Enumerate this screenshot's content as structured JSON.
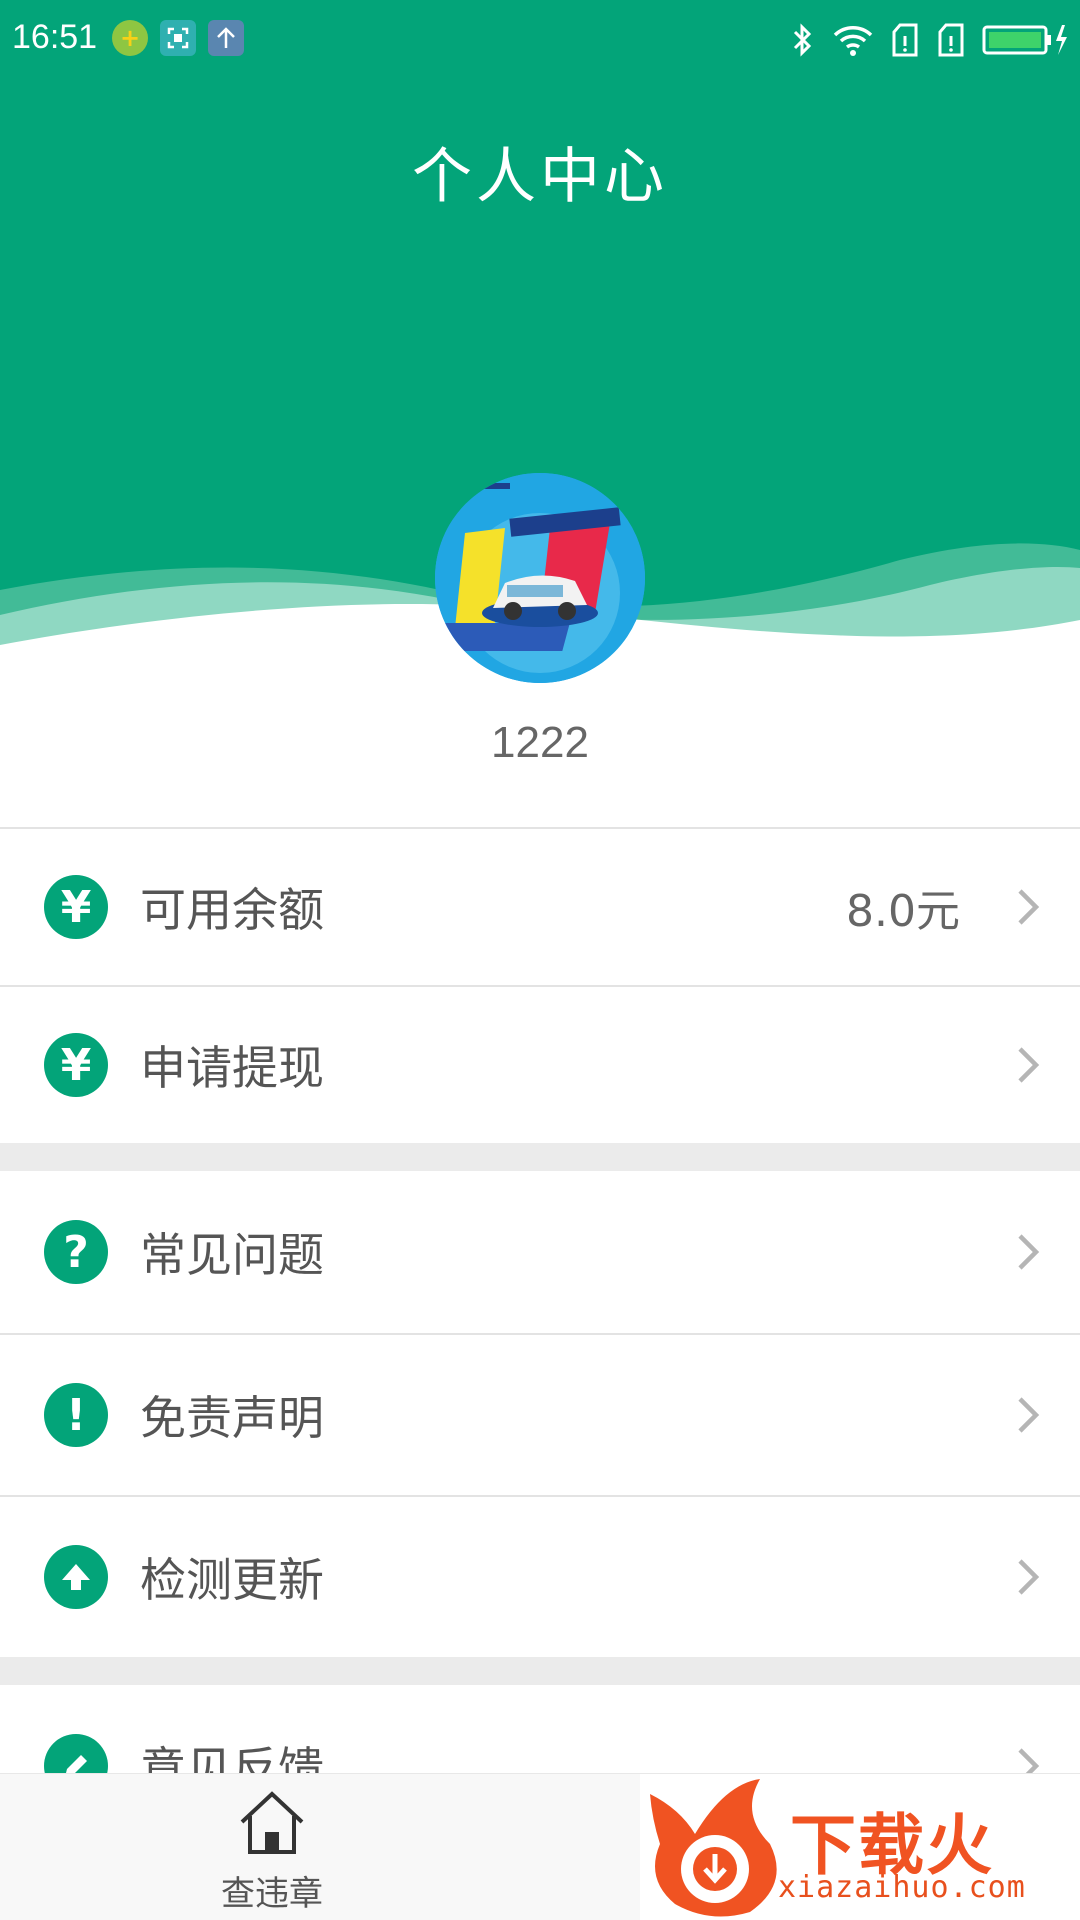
{
  "status_bar": {
    "time": "16:51"
  },
  "header": {
    "title": "个人中心",
    "background_color": "#03a479"
  },
  "profile": {
    "username": "1222",
    "avatar_icon": "car-promo-avatar"
  },
  "menu": {
    "balance": {
      "label": "可用余额",
      "value": "8.0元",
      "icon": "yen-icon"
    },
    "withdraw": {
      "label": "申请提现",
      "icon": "yen-icon"
    },
    "faq": {
      "label": "常见问题",
      "icon": "question-icon"
    },
    "disclaimer": {
      "label": "免责声明",
      "icon": "exclamation-icon"
    },
    "update": {
      "label": "检测更新",
      "icon": "upload-arrow-icon"
    },
    "feedback": {
      "label": "意见反馈",
      "icon": "pencil-icon"
    }
  },
  "tabbar": {
    "tabs": [
      {
        "label": "查违章",
        "icon": "home-icon"
      }
    ]
  },
  "watermark": {
    "text": "下载火",
    "url": "xiazaihuo.com"
  },
  "colors": {
    "accent": "#03a479",
    "divider": "#e3e3e3",
    "section_gap": "#ebebeb"
  }
}
